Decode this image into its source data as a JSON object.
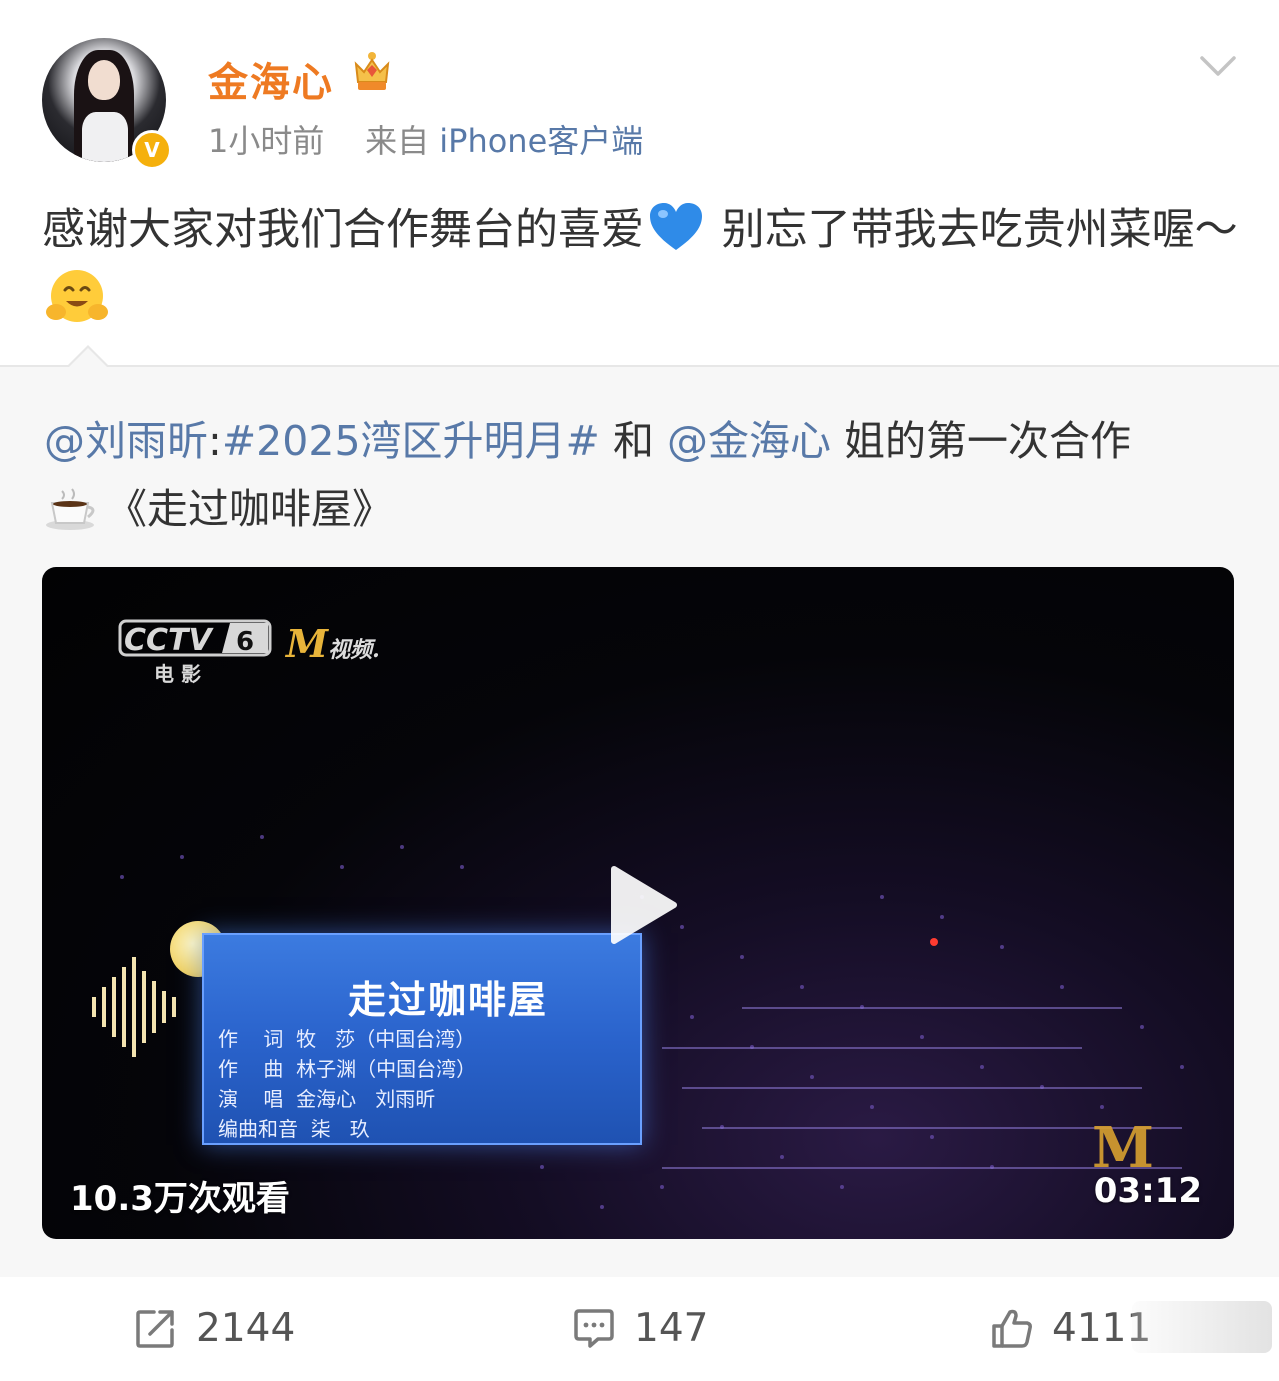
{
  "post": {
    "username": "金海心",
    "time": "1小时前",
    "source_prefix": "来自",
    "source": "iPhone客户端",
    "verified_badge": "V",
    "text_part1": "感谢大家对我们合作舞台的喜爱",
    "text_part2": "别忘了带我去吃贵州菜喔～",
    "icons": [
      "crown-level-icon",
      "chevron-down-icon",
      "blue-heart-emoji",
      "hugging-face-emoji"
    ]
  },
  "repost": {
    "author_mention": "@刘雨昕",
    "colon": ":",
    "hashtag": "#2025湾区升明月#",
    "text_mid": "和",
    "mention2": "@金海心",
    "text_end": "姐的第一次合作",
    "song_title": "《走过咖啡屋》",
    "icons": [
      "coffee-cup-emoji"
    ]
  },
  "video": {
    "channel_logo": "CCTV 6",
    "channel_sub": "电 影",
    "m_logo": "M",
    "m_logo_text": "视频.",
    "card_title": "走过咖啡屋",
    "credits": [
      "作    词  牧   莎（中国台湾）",
      "作    曲  林子渊（中国台湾）",
      "演    唱  金海心   刘雨昕",
      "编曲和音  柒   玖"
    ],
    "views": "10.3万次观看",
    "duration": "03:12",
    "watermark": "M"
  },
  "actions": {
    "repost_count": "2144",
    "comment_count": "147",
    "like_count": "4111"
  },
  "colors": {
    "username": "#ee7a22",
    "link": "#5879a8",
    "meta": "#8a8a8a",
    "badge": "#f5b00c"
  }
}
